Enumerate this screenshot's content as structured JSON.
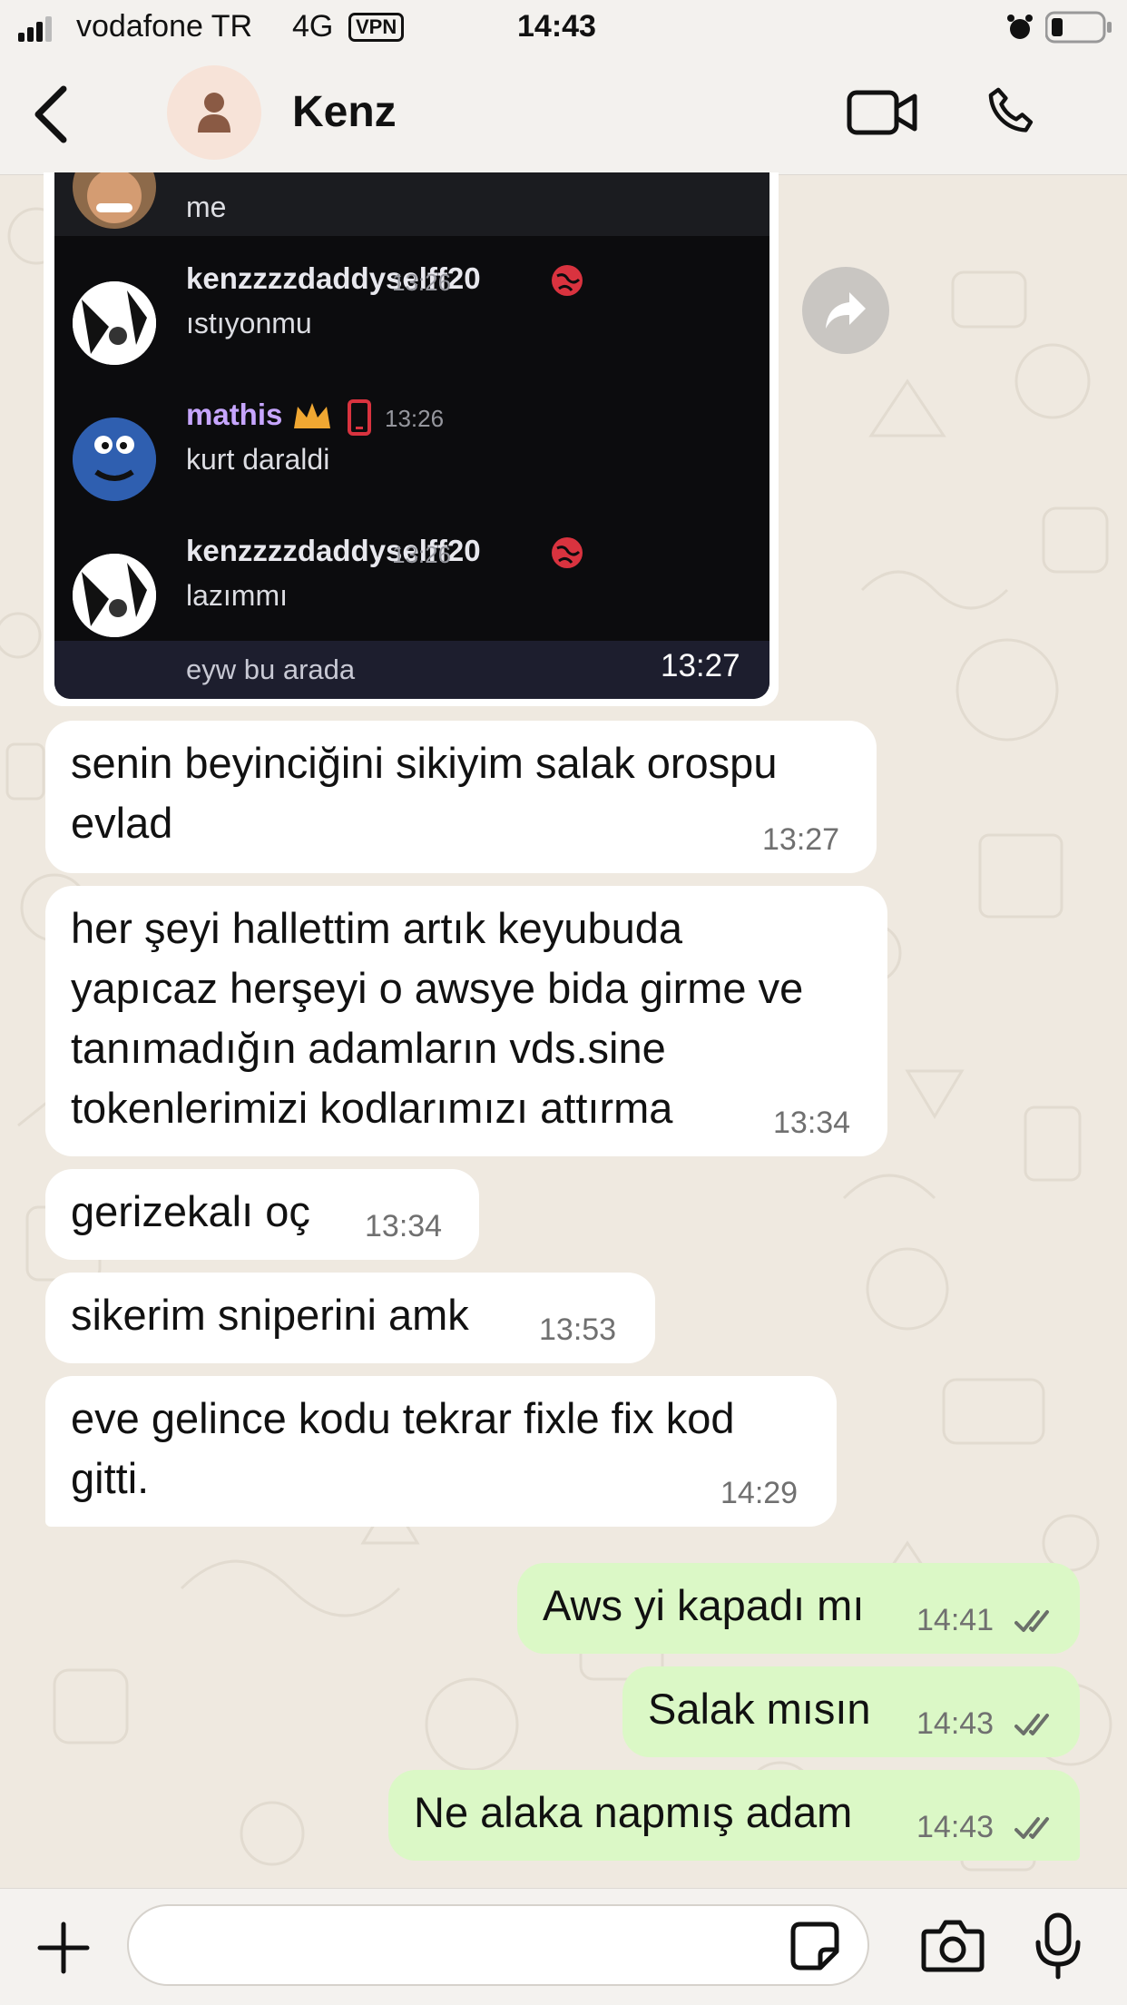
{
  "status_bar": {
    "carrier": "vodafone TR",
    "network": "4G",
    "vpn": "VPN",
    "time": "14:43"
  },
  "header": {
    "contact_name": "Kenz",
    "back_icon": "chevron-left-icon",
    "avatar_icon": "person-icon",
    "video_icon": "video-call-icon",
    "phone_icon": "phone-icon"
  },
  "image_message": {
    "time": "13:27",
    "discord": {
      "top_message": "me",
      "messages": [
        {
          "user": "kenzzzzdaddyselff20",
          "time": "13:26",
          "text": "ıstıyonmu"
        },
        {
          "user": "mathis",
          "time": "13:26",
          "text": "kurt daraldi"
        },
        {
          "user": "kenzzzzdaddyselff20",
          "time": "13:26",
          "text": "lazımmı"
        }
      ],
      "input_text": "eyw bu arada"
    }
  },
  "messages": [
    {
      "lines": "senin beyinciğini sikiyim salak orospu\nevlad",
      "time": "13:27",
      "outgoing": false
    },
    {
      "lines": "her şeyi hallettim artık keyubuda\nyapıcaz herşeyi o awsye bida girme ve\ntanımadığın adamların vds.sine\ntokenlerimizi kodlarımızı attırma",
      "time": "13:34",
      "outgoing": false
    },
    {
      "lines": "gerizekalı oç",
      "time": "13:34",
      "outgoing": false
    },
    {
      "lines": "sikerim sniperini amk",
      "time": "13:53",
      "outgoing": false
    },
    {
      "lines": "eve gelince kodu tekrar fixle fix kod\ngitti.",
      "time": "14:29",
      "outgoing": false
    },
    {
      "lines": "Aws yi kapadı mı",
      "time": "14:41",
      "outgoing": true
    },
    {
      "lines": "Salak mısın",
      "time": "14:43",
      "outgoing": true
    },
    {
      "lines": "Ne alaka napmış adam",
      "time": "14:43",
      "outgoing": true
    }
  ],
  "composer": {
    "input_value": "",
    "plus_icon": "plus-icon",
    "sticker_icon": "sticker-icon",
    "camera_icon": "camera-icon",
    "mic_icon": "microphone-icon"
  },
  "colors": {
    "outgoing_bubble": "#dbf8c6",
    "incoming_bubble": "#ffffff",
    "wallpaper": "#efe9e0",
    "read_ticks": "#53bdeb"
  }
}
